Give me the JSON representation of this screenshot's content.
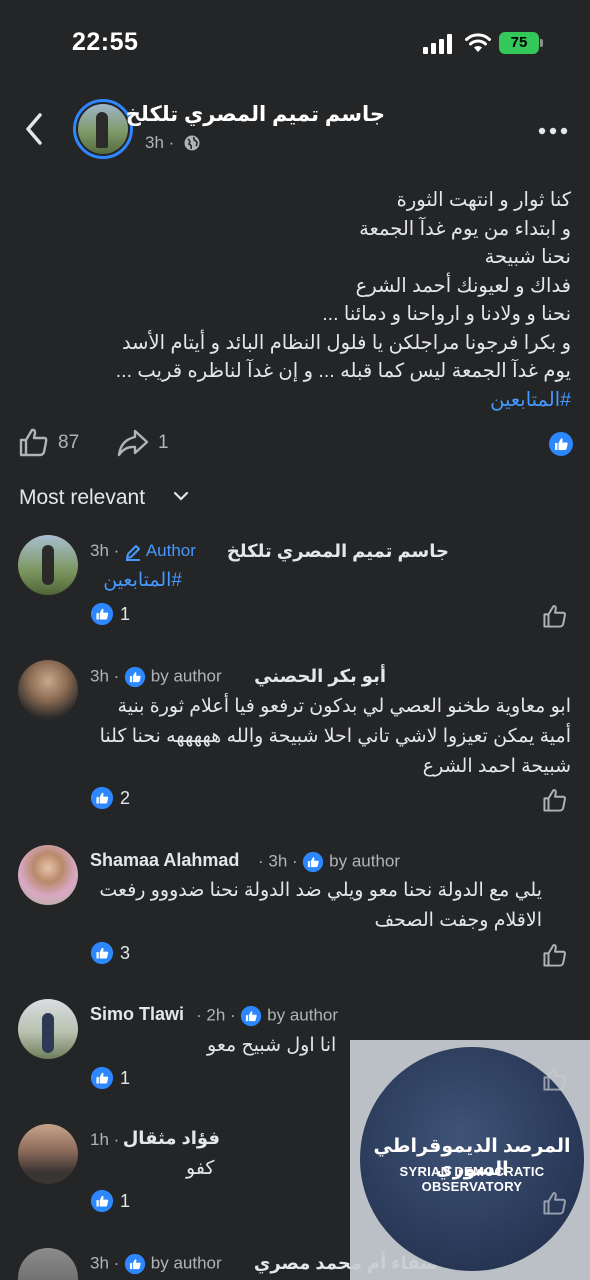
{
  "status_bar": {
    "time": "22:55",
    "battery": "75"
  },
  "post": {
    "author": "جاسم تميم المصري تلكلخ",
    "time": "3h",
    "lines": [
      "كنا ثوار و انتهت الثورة",
      "و ابتداء من يوم غدآ الجمعة",
      "نحنا شبيحة",
      "فداك و لعيونك أحمد الشرع",
      "نحنا و ولادنا و ارواحنا و دمائنا ...",
      "و بكرا فرجونا مراجلكن يا فلول النظام البائد و أيتام الأسد",
      "يوم غدآ الجمعة ليس كما قبله ... و إن غدآ لناظره قريب ..."
    ],
    "hashtag": "#المتابعين",
    "likes": "87",
    "shares": "1"
  },
  "sort_label": "Most relevant",
  "comments": [
    {
      "name": "جاسم تميم  المصري  تلكلخ",
      "time": "3h",
      "tag": "Author",
      "text": "#المتابعين",
      "reactions": "1"
    },
    {
      "name": "أبو  بكر  الحصني",
      "time": "3h",
      "tag": "by author",
      "text": "ابو معاوية طخنو العصي لي بدكون ترفعو فيا أعلام ثورة بنية أمية يمكن تعيزوا لاشي تاني احلا شبيحة والله هههههه نحنا كلنا شبيحة احمد الشرع",
      "reactions": "2"
    },
    {
      "name": "Shamaa Alahmad",
      "time": "3h",
      "tag": "by author",
      "text": "يلي مع الدولة نحنا معو ويلي ضد الدولة نحنا ضدووو رفعت الاقلام وجفت الصحف",
      "reactions": "3"
    },
    {
      "name": "Simo Tlawi",
      "time": "2h",
      "tag": "by author",
      "text": "انا اول شبيح معو",
      "reactions": "1"
    },
    {
      "name": "فؤاد  مثقال",
      "time": "1h",
      "tag": "",
      "text": "كفو",
      "reactions": "1"
    },
    {
      "name": "شفاء  أم  محمد  مصري",
      "time": "3h",
      "tag": "by author",
      "text": "",
      "reactions": ""
    }
  ],
  "watermark": {
    "arabic": "المرصد الديموقراطي السوري",
    "english": "SYRIAN DEMOCRATIC OBSERVATORY"
  },
  "colors": {
    "background": "#242526",
    "accent": "#2d88ff",
    "link": "#4599ff",
    "battery": "#34c759"
  }
}
